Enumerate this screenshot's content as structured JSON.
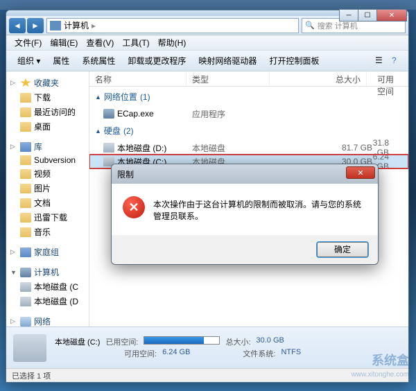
{
  "address": {
    "location": "计算机",
    "search_placeholder": "搜索 计算机"
  },
  "menu": {
    "file": "文件(F)",
    "edit": "编辑(E)",
    "view": "查看(V)",
    "tools": "工具(T)",
    "help": "帮助(H)"
  },
  "toolbar": {
    "organize": "组织",
    "properties": "属性",
    "sysprops": "系统属性",
    "uninstall": "卸载或更改程序",
    "mapdrive": "映射网络驱动器",
    "controlpanel": "打开控制面板"
  },
  "columns": {
    "name": "名称",
    "type": "类型",
    "total": "总大小",
    "free": "可用空间"
  },
  "sidebar": {
    "favorites": "收藏夹",
    "fav_items": [
      "下载",
      "最近访问的",
      "桌面"
    ],
    "libraries": "库",
    "lib_items": [
      "Subversion",
      "视频",
      "图片",
      "文档",
      "迅雷下载",
      "音乐"
    ],
    "homegroup": "家庭组",
    "computer": "计算机",
    "comp_items": [
      "本地磁盘 (C",
      "本地磁盘 (D"
    ],
    "network": "网络"
  },
  "groups": {
    "netloc": {
      "title": "网络位置",
      "count": "(1)",
      "items": [
        {
          "name": "ECap.exe",
          "type": "应用程序"
        }
      ]
    },
    "disks": {
      "title": "硬盘",
      "count": "(2)",
      "items": [
        {
          "name": "本地磁盘 (D:)",
          "type": "本地磁盘",
          "total": "81.7 GB",
          "free": "31.8 GB"
        },
        {
          "name": "本地磁盘 (C:)",
          "type": "本地磁盘",
          "total": "30.0 GB",
          "free": "6.24 GB"
        }
      ]
    }
  },
  "details": {
    "name": "本地磁盘 (C:)",
    "used_label": "已用空间:",
    "free_label": "可用空间:",
    "free_val": "6.24 GB",
    "total_label": "总大小:",
    "total_val": "30.0 GB",
    "fs_label": "文件系统:",
    "fs_val": "NTFS"
  },
  "status": "已选择 1 项",
  "dialog": {
    "title": "限制",
    "message": "本次操作由于这台计算机的限制而被取消。请与您的系统管理员联系。",
    "ok": "确定"
  },
  "watermark": {
    "text": "系统盒",
    "url": "www.xitonghe.com"
  }
}
